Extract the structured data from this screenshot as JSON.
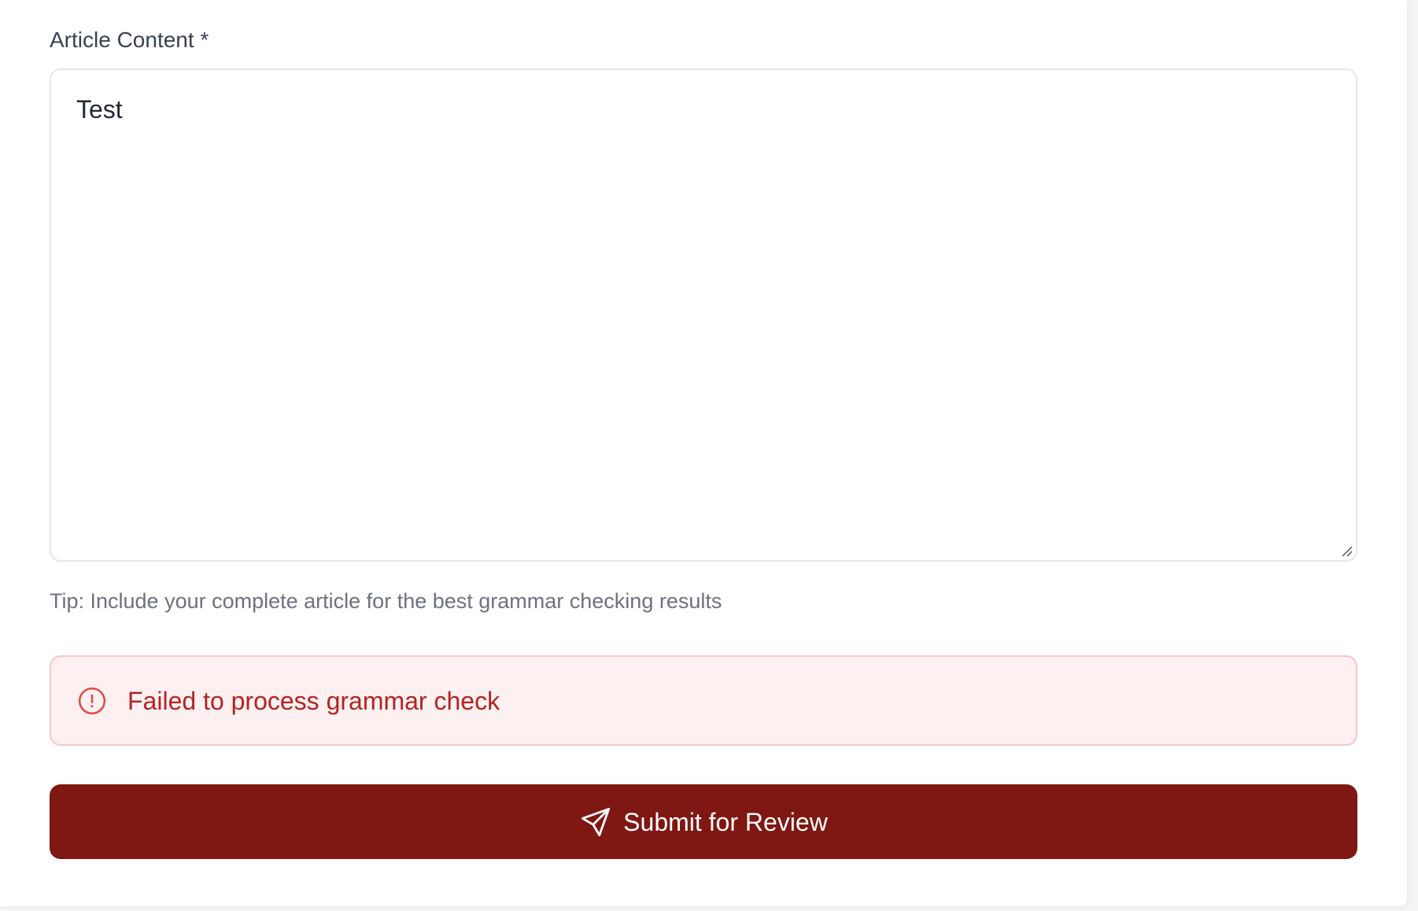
{
  "form": {
    "content_label": "Article Content *",
    "content_value": "Test",
    "tip": "Tip: Include your complete article for the best grammar checking results"
  },
  "error": {
    "icon": "alert-circle-icon",
    "message": "Failed to process grammar check"
  },
  "submit": {
    "icon": "send-icon",
    "label": "Submit for Review"
  },
  "colors": {
    "brand": "#7f1712",
    "error_text": "#b42323",
    "error_background": "#fdf0f0",
    "error_border": "#f6c7c7",
    "label_text": "#374151",
    "muted_text": "#6b7280"
  }
}
